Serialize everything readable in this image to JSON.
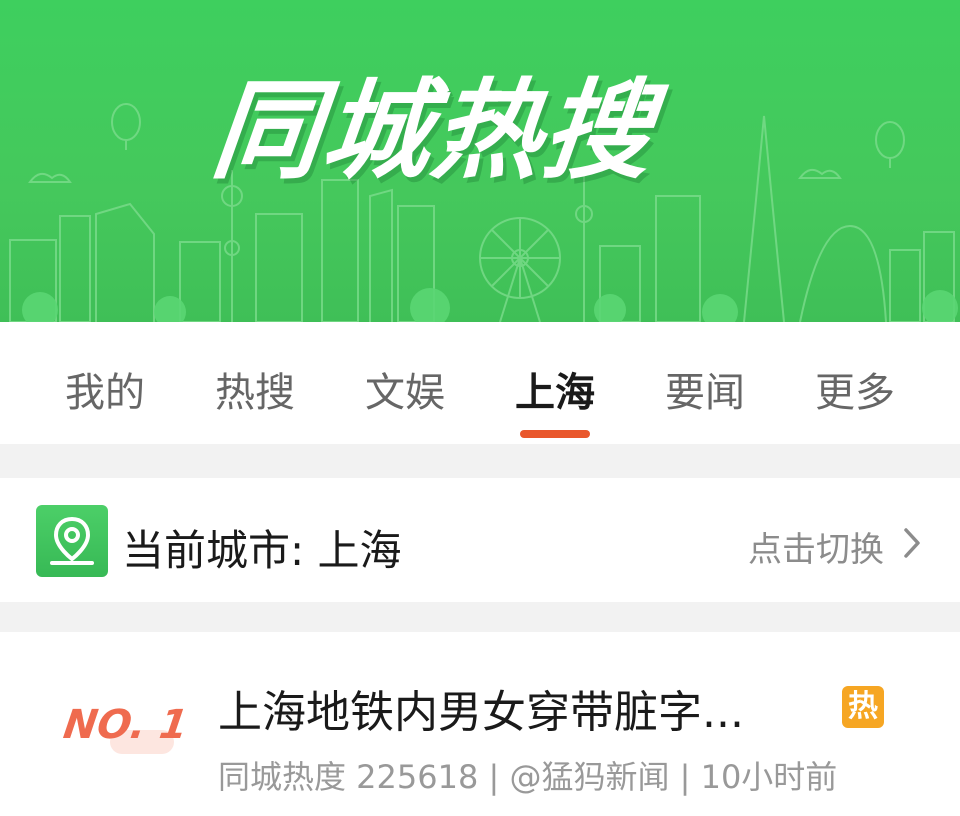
{
  "banner": {
    "title": "同城热搜"
  },
  "tabs": [
    {
      "label": "我的",
      "active": false
    },
    {
      "label": "热搜",
      "active": false
    },
    {
      "label": "文娱",
      "active": false
    },
    {
      "label": "上海",
      "active": true
    },
    {
      "label": "要闻",
      "active": false
    },
    {
      "label": "更多",
      "active": false
    }
  ],
  "city": {
    "label": "当前城市: 上海",
    "switch_label": "点击切换",
    "icon": "location-pin-icon"
  },
  "news": [
    {
      "rank": "NO. 1",
      "title": "上海地铁内男女穿带脏字...",
      "badge": "热",
      "meta": "同城热度 225618 | @猛犸新闻 | 10小时前"
    }
  ],
  "colors": {
    "banner_green": "#45c85c",
    "tab_indicator": "#e9572c",
    "rank_color": "#ef6b4f",
    "hot_badge": "#f6a623"
  }
}
